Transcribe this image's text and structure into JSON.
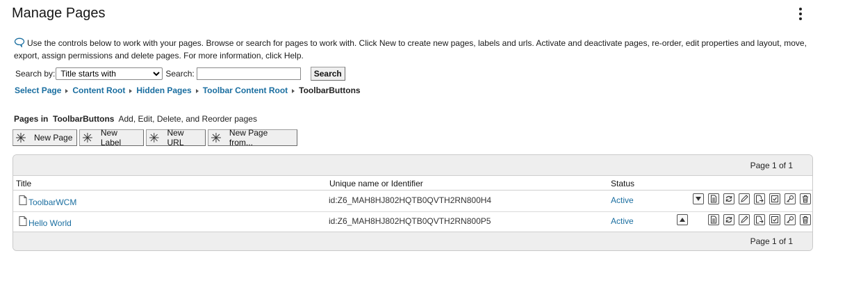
{
  "header": {
    "title": "Manage Pages",
    "menu_icon": "kebab-menu-icon"
  },
  "help": {
    "icon": "speech-bubble-help-icon",
    "text": "Use the controls below to work with your pages. Browse or search for pages to work with. Click New to create new pages, labels and urls. Activate and deactivate pages, re-order, edit properties and layout, move, export, assign permissions and delete pages. For more information, click Help."
  },
  "search": {
    "search_by_label": "Search by:",
    "search_by_selected": "Title starts with",
    "search_label": "Search:",
    "query_value": "",
    "button_label": "Search"
  },
  "breadcrumb": {
    "items": [
      "Select Page",
      "Content Root",
      "Hidden Pages",
      "Toolbar Content Root"
    ],
    "current": "ToolbarButtons"
  },
  "pages_in": {
    "prefix": "Pages in",
    "page_name": "ToolbarButtons",
    "suffix": "Add, Edit, Delete, and Reorder pages"
  },
  "buttons": {
    "new_page": "New Page",
    "new_label": "New Label",
    "new_url": "New URL",
    "new_page_from": "New Page from..."
  },
  "table": {
    "pager_top": "Page 1 of 1",
    "pager_bottom": "Page 1 of 1",
    "columns": {
      "title": "Title",
      "uid": "Unique name or Identifier",
      "status": "Status"
    },
    "rows": [
      {
        "title": "ToolbarWCM",
        "uid": "id:Z6_MAH8HJ802HQTB0QVTH2RN800H4",
        "status": "Active"
      },
      {
        "title": "Hello World",
        "uid": "id:Z6_MAH8HJ802HQTB0QVTH2RN800P5",
        "status": "Active"
      }
    ],
    "action_icons": [
      "move-down-icon",
      "move-up-icon",
      "properties-icon",
      "activate-icon",
      "edit-icon",
      "move-icon",
      "edit-layout-icon",
      "permissions-icon",
      "delete-icon"
    ]
  },
  "colors": {
    "link": "#1a6ea0",
    "table_header_bg": "#eeeeee",
    "button_bg": "#efefef"
  }
}
